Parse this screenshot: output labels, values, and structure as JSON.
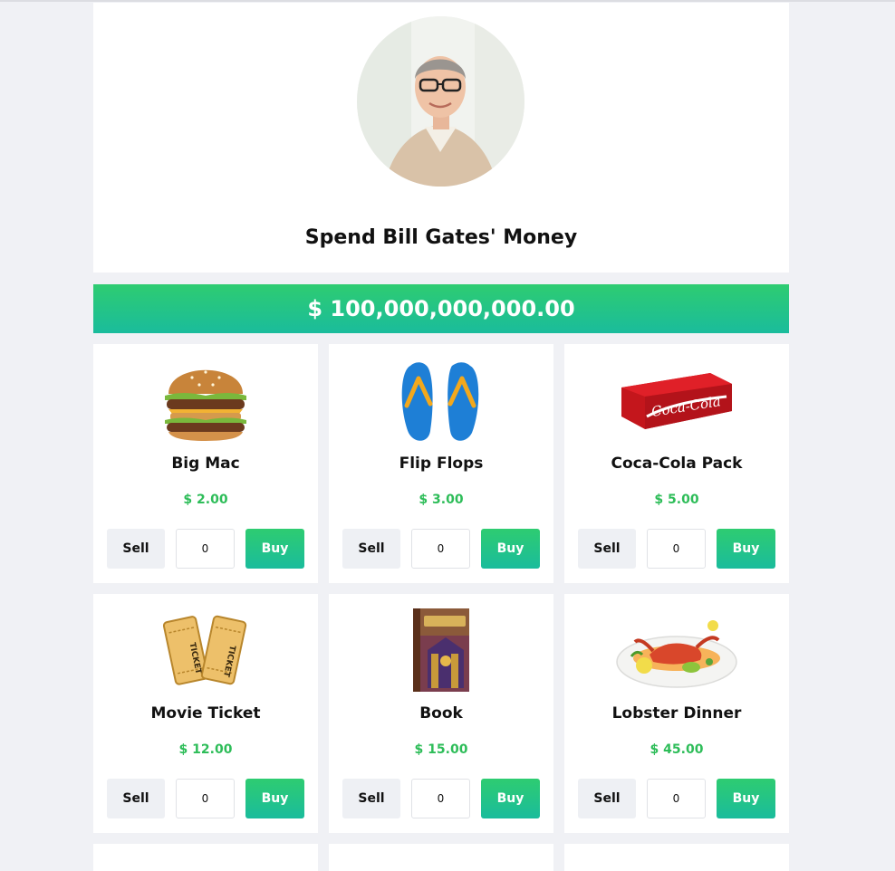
{
  "header": {
    "title": "Spend Bill Gates' Money",
    "avatar_alt": "Bill Gates portrait"
  },
  "balance": "$ 100,000,000,000.00",
  "colors": {
    "accent_top": "#2ecc71",
    "accent_bottom": "#1abc9c",
    "price": "#2ebd59",
    "background": "#f0f1f5"
  },
  "items": [
    {
      "name": "Big Mac",
      "price": "$ 2.00",
      "quantity": "0",
      "sell_label": "Sell",
      "buy_label": "Buy",
      "icon": "burger-icon"
    },
    {
      "name": "Flip Flops",
      "price": "$ 3.00",
      "quantity": "0",
      "sell_label": "Sell",
      "buy_label": "Buy",
      "icon": "flip-flops-icon"
    },
    {
      "name": "Coca-Cola Pack",
      "price": "$ 5.00",
      "quantity": "0",
      "sell_label": "Sell",
      "buy_label": "Buy",
      "icon": "soda-pack-icon"
    },
    {
      "name": "Movie Ticket",
      "price": "$ 12.00",
      "quantity": "0",
      "sell_label": "Sell",
      "buy_label": "Buy",
      "icon": "ticket-icon"
    },
    {
      "name": "Book",
      "price": "$ 15.00",
      "quantity": "0",
      "sell_label": "Sell",
      "buy_label": "Buy",
      "icon": "book-icon"
    },
    {
      "name": "Lobster Dinner",
      "price": "$ 45.00",
      "quantity": "0",
      "sell_label": "Sell",
      "buy_label": "Buy",
      "icon": "lobster-plate-icon"
    }
  ]
}
